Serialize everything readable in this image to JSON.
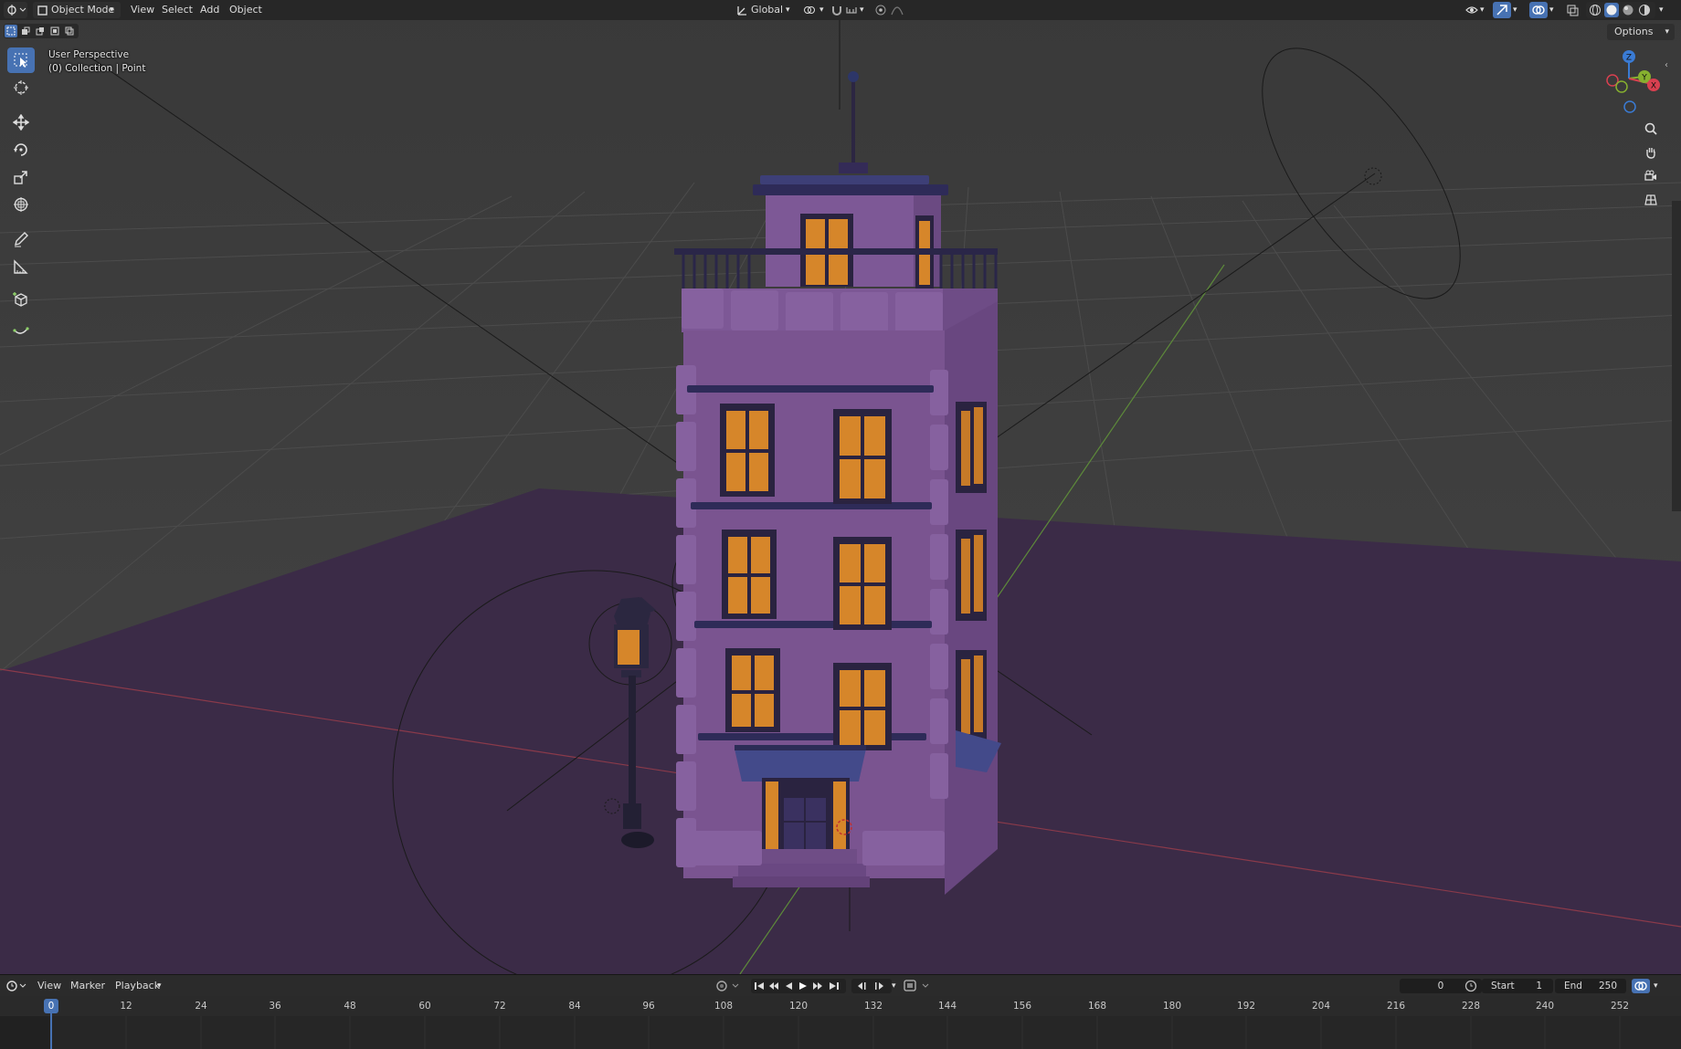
{
  "header": {
    "mode_label": "Object Mode",
    "menu_items": [
      "View",
      "Select",
      "Add",
      "Object"
    ],
    "transform_orientation": "Global",
    "options_label": "Options"
  },
  "viewport": {
    "view_name": "User Perspective",
    "collection_info": "(0) Collection | Point",
    "gizmo_axes": {
      "z": "Z",
      "y": "Y",
      "x": "X"
    }
  },
  "toolbar": {
    "tools": [
      "select-box",
      "cursor",
      "move",
      "rotate",
      "scale",
      "transform",
      "annotate",
      "measure",
      "add-cube",
      "curve"
    ],
    "active_tool": "select-box"
  },
  "timeline": {
    "menu_items": [
      "View",
      "Marker",
      "Playback"
    ],
    "current_frame": "0",
    "start_label": "Start",
    "start_value": "1",
    "end_label": "End",
    "end_value": "250",
    "playhead_label": "0",
    "ruler_ticks": [
      "12",
      "24",
      "36",
      "48",
      "60",
      "72",
      "84",
      "96",
      "108",
      "120",
      "132",
      "144",
      "156",
      "168",
      "180",
      "192",
      "204",
      "216",
      "228",
      "240",
      "252"
    ]
  },
  "colors": {
    "accent": "#4772b3",
    "building": "#7a5490",
    "window_glow": "#d6862a",
    "floor": "#3b2b47",
    "viewport_bg": "#3d3d3d"
  }
}
